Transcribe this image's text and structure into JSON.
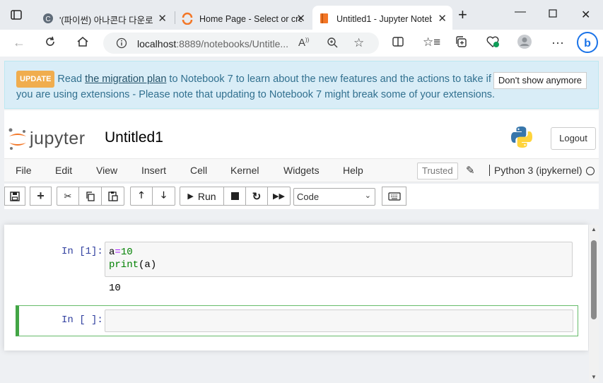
{
  "browser": {
    "tabs": [
      {
        "title": "'(파이썬) 아나콘다 다운로"
      },
      {
        "title": "Home Page - Select or cre"
      },
      {
        "title": "Untitled1 - Jupyter Noteb"
      }
    ],
    "url": "localhost:8889/notebooks/Untitle...",
    "url_host": "localhost",
    "url_rest": ":8889/notebooks/Untitle..."
  },
  "banner": {
    "badge": "UPDATE",
    "pre": "Read ",
    "link": "the migration plan",
    "post": " to Notebook 7 to learn about the new features and the actions to take if you are using extensions - Please note that updating to Notebook 7 might break some of your extensions.",
    "dismiss": "Don't show anymore"
  },
  "header": {
    "logo_text": "jupyter",
    "notebook_name": "Untitled1",
    "logout": "Logout"
  },
  "menu": {
    "items": [
      "File",
      "Edit",
      "View",
      "Insert",
      "Cell",
      "Kernel",
      "Widgets",
      "Help"
    ],
    "trusted": "Trusted",
    "kernel": "Python 3 (ipykernel)"
  },
  "toolbar": {
    "run_label": "Run",
    "cell_type": "Code"
  },
  "cells": [
    {
      "prompt": "In [1]:",
      "code_line1_a": "a",
      "code_line1_eq": "=",
      "code_line1_num": "10",
      "code_line2_fn": "print",
      "code_line2_rest": "(a)",
      "output": "10"
    },
    {
      "prompt": "In [ ]:"
    }
  ],
  "colors": {
    "accent": "#f37626",
    "selected_cell": "#42a545",
    "banner_bg": "#d9edf7"
  }
}
